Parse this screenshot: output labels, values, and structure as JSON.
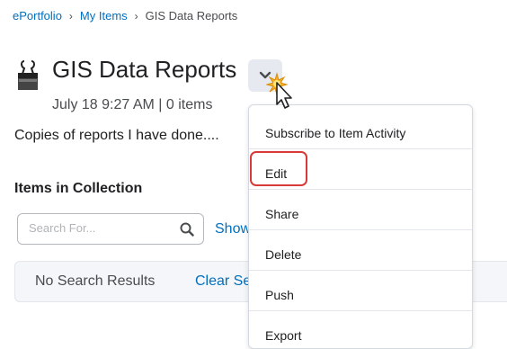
{
  "breadcrumb": {
    "items": [
      "ePortfolio",
      "My Items"
    ],
    "current": "GIS Data Reports",
    "separator": "›"
  },
  "item": {
    "title": "GIS Data Reports",
    "meta": "July 18 9:27 AM | 0 items",
    "description": "Copies of reports I have done....",
    "icon": "binder-clip-icon"
  },
  "collection": {
    "heading": "Items in Collection",
    "search_placeholder": "Search For...",
    "show_link": "Show",
    "no_results": "No Search Results",
    "clear_search": "Clear Se"
  },
  "menu": {
    "items": [
      "Subscribe to Item Activity",
      "Edit",
      "Share",
      "Delete",
      "Push",
      "Export"
    ],
    "highlighted": "Edit"
  },
  "colors": {
    "link": "#006fbf",
    "highlight": "#d83a3a",
    "button_bg": "#e6eaf0"
  }
}
